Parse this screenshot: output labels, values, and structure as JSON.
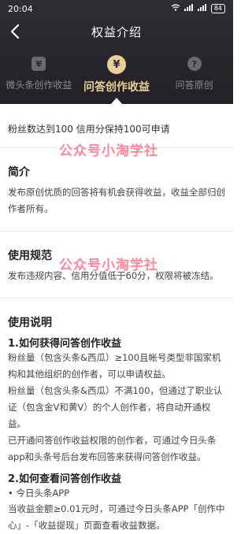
{
  "status": {
    "time": "20:04",
    "battery": "84"
  },
  "nav": {
    "title": "权益介绍"
  },
  "tabs": [
    {
      "label": "微头条创作收益",
      "icon": "¥"
    },
    {
      "label": "问答创作收益",
      "icon": "¥"
    },
    {
      "label": "问答原创",
      "icon": "?"
    }
  ],
  "intro": "粉丝数达到100 信用分保持100可申请",
  "sections": {
    "summary": {
      "title": "简介",
      "body": "发布原创优质的回答将有机会获得收益，收益全部归创作者所有。"
    },
    "rules": {
      "title": "使用规范",
      "body": "发布违规内容、信用分值低于60分，权限将被冻结。"
    },
    "guide": {
      "title": "使用说明",
      "q1": "1.如何获得问答创作收益",
      "q1_p1": "粉丝量（包含头条&西瓜）≥100且帐号类型非国家机构和其他组织的创作者，可以申请权益。",
      "q1_p2": "粉丝量（包含头条&西瓜）不满100，但通过了职业认证（包含金V和黄V）的个人创作者，将自动开通权益。",
      "q1_p3": "已开通问答创作收益权限的创作者，可通过今日头条app和头条号后台发布回答来获得问答创作收益。",
      "q2": "2.如何查看问答创作收益",
      "q2_bullet": "• 今日头条APP",
      "q2_p1": "当收益金额≥0.01元时，可通过今日头条APP「创作中心」-「收益提现」页面查看收益数据。"
    }
  },
  "watermark": "公众号小淘学社"
}
